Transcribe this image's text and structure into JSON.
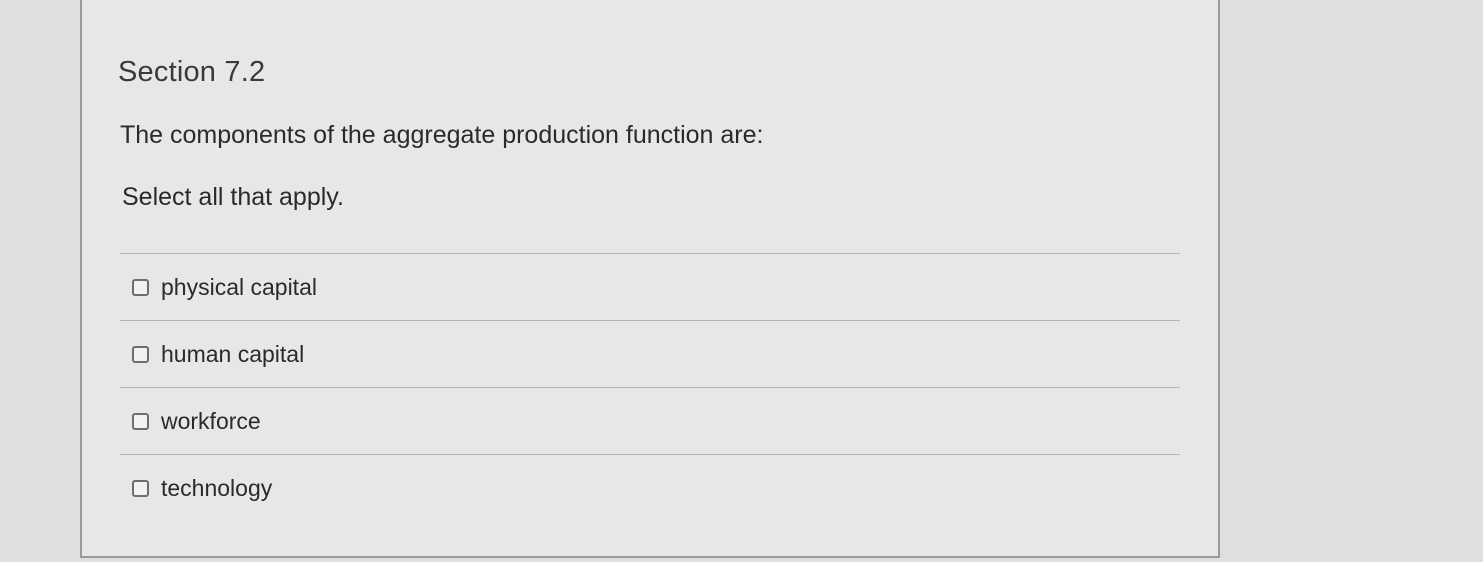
{
  "section": {
    "title": "Section 7.2"
  },
  "question": {
    "text": "The components of the aggregate production function are:",
    "instruction": "Select all that apply."
  },
  "options": [
    {
      "label": "physical capital",
      "checked": false
    },
    {
      "label": "human capital",
      "checked": false
    },
    {
      "label": "workforce",
      "checked": false
    },
    {
      "label": "technology",
      "checked": false
    }
  ]
}
